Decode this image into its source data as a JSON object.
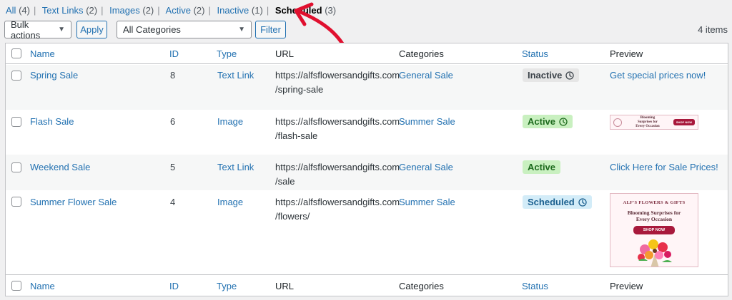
{
  "views": [
    {
      "label": "All",
      "count": "(4)",
      "current": false
    },
    {
      "label": "Text Links",
      "count": "(2)",
      "current": false
    },
    {
      "label": "Images",
      "count": "(2)",
      "current": false
    },
    {
      "label": "Active",
      "count": "(2)",
      "current": false
    },
    {
      "label": "Inactive",
      "count": "(1)",
      "current": false
    },
    {
      "label": "Scheduled",
      "count": "(3)",
      "current": true
    }
  ],
  "toolbar": {
    "bulk_actions": "Bulk actions",
    "apply": "Apply",
    "categories": "All Categories",
    "filter": "Filter",
    "items_count": "4 items"
  },
  "columns": {
    "name": "Name",
    "id": "ID",
    "type": "Type",
    "url": "URL",
    "categories": "Categories",
    "status": "Status",
    "preview": "Preview"
  },
  "rows": [
    {
      "name": "Spring Sale",
      "id": "8",
      "type": "Text Link",
      "url_line1": "https://alfsflowersandgifts.com",
      "url_line2": "/spring-sale",
      "category": "General Sale",
      "status": "Inactive",
      "preview_text": "Get special prices now!"
    },
    {
      "name": "Flash Sale",
      "id": "6",
      "type": "Image",
      "url_line1": "https://alfsflowersandgifts.com",
      "url_line2": "/flash-sale",
      "category": "Summer Sale",
      "status": "Active",
      "preview_text": ""
    },
    {
      "name": "Weekend Sale",
      "id": "5",
      "type": "Text Link",
      "url_line1": "https://alfsflowersandgifts.com",
      "url_line2": "/sale",
      "category": "General Sale",
      "status": "Active",
      "preview_text": "Click Here for Sale Prices!"
    },
    {
      "name": "Summer Flower Sale",
      "id": "4",
      "type": "Image",
      "url_line1": "https://alfsflowersandgifts.com",
      "url_line2": "/flowers/",
      "category": "Summer Sale",
      "status": "Scheduled",
      "preview_text": ""
    }
  ],
  "banner_small": {
    "line1": "Blooming",
    "line2": "Surprises for",
    "line3": "Every Occasion",
    "shop": "SHOP NOW",
    "brand": "ALF'S FLOWERS & GIFTS"
  },
  "banner_tall": {
    "brand": "ALF'S FLOWERS & GIFTS",
    "line1": "Blooming Surprises for",
    "line2": "Every Occasion",
    "shop": "SHOP NOW"
  },
  "colors": {
    "link": "#2271b1",
    "annotation": "#e0102f",
    "inactive_bg": "#e6e6e6",
    "active_bg": "#c9f0c0",
    "scheduled_bg": "#d3ecf8"
  },
  "icons": {
    "status_clock": "clock-icon",
    "select_chevron": "chevron-down-icon",
    "annotation": "arrow-icon"
  }
}
